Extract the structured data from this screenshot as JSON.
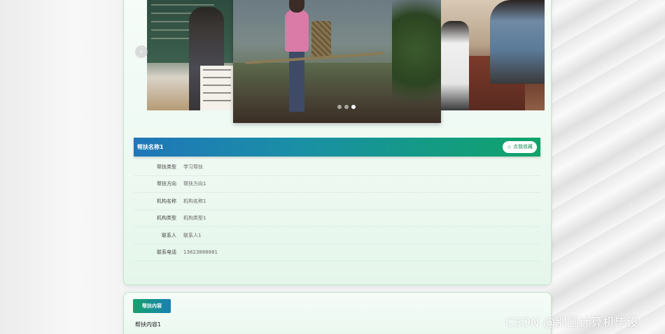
{
  "detail": {
    "title": "帮扶名称1",
    "favorite_label": "点我收藏",
    "fields": [
      {
        "label": "帮扶类型",
        "value": "学习帮扶"
      },
      {
        "label": "帮扶方向",
        "value": "帮扶方向1"
      },
      {
        "label": "机构名称",
        "value": "机构名称1"
      },
      {
        "label": "机构类型",
        "value": "机构类型1"
      },
      {
        "label": "联系人",
        "value": "联系人1"
      },
      {
        "label": "联系电话",
        "value": "13823888881"
      }
    ]
  },
  "content": {
    "tab_label": "帮扶内容",
    "text": "帮扶内容1"
  },
  "carousel": {
    "dot_count": 3,
    "active_dot": 2
  },
  "watermark": {
    "text": "CSDN @别圆计算机毕设"
  },
  "colors": {
    "accent_blue": "#1f77b9",
    "accent_green": "#0fa469",
    "card_bg": "#eef9f2"
  },
  "icons": {
    "favorite": "star-icon",
    "prev": "chevron-left-icon"
  }
}
